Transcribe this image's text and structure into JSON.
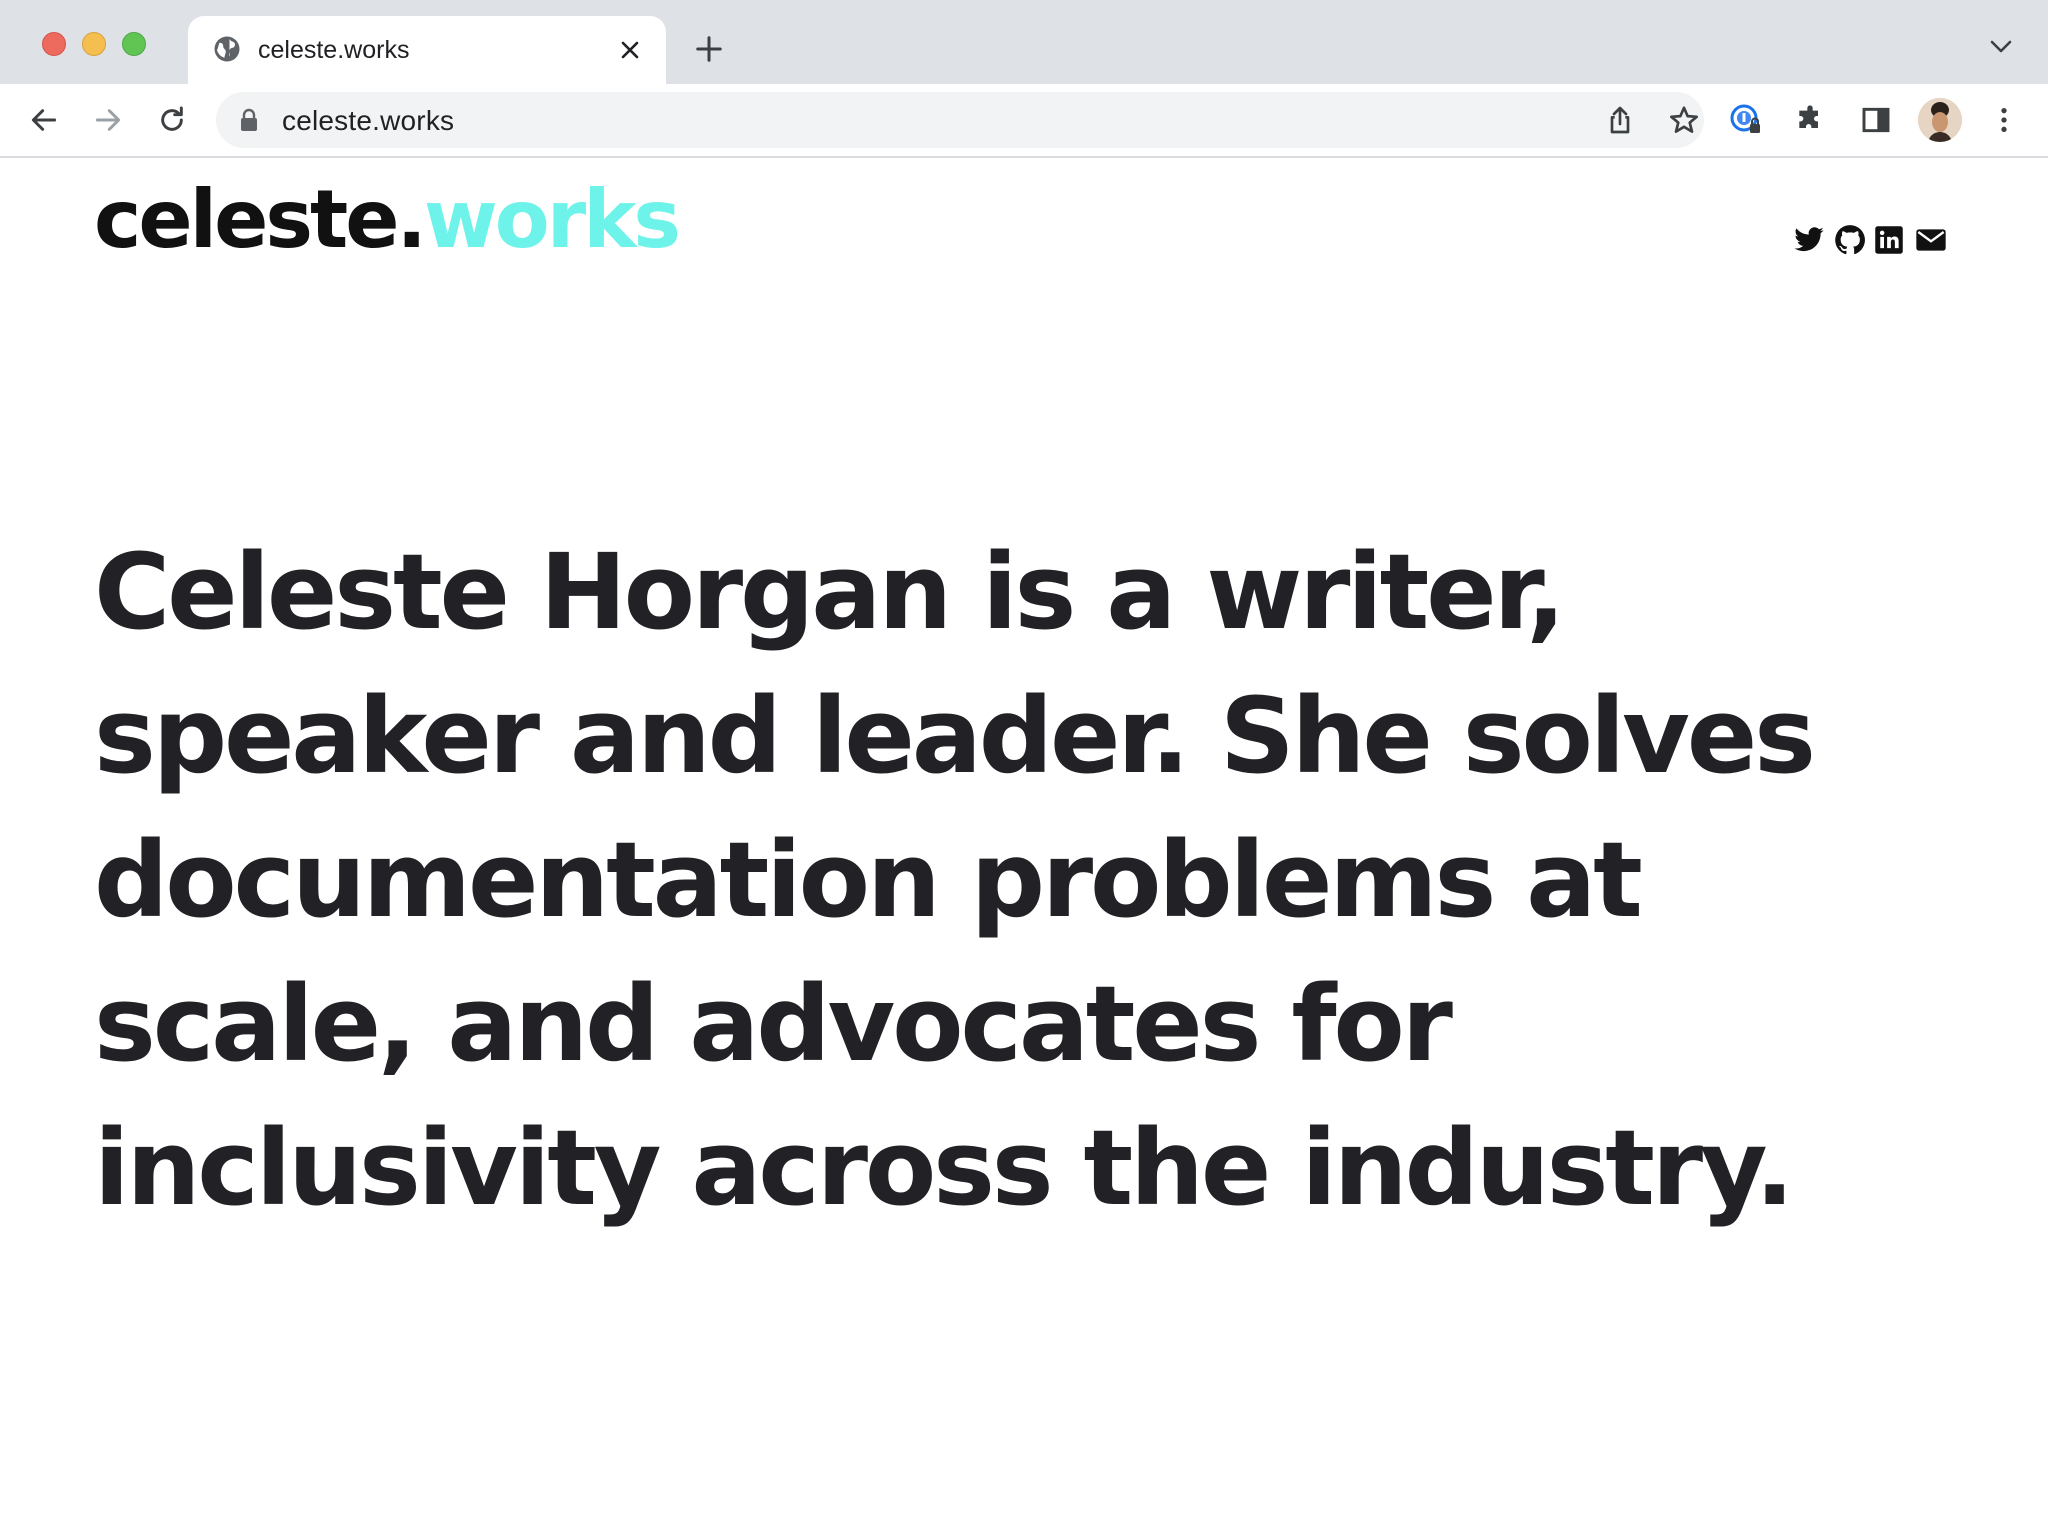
{
  "browser": {
    "tab": {
      "title": "celeste.works"
    },
    "address_bar": {
      "url": "celeste.works"
    }
  },
  "site": {
    "logo": {
      "part1": "celeste.",
      "part2": "works",
      "accent_color": "#6ef3ea"
    },
    "social_links": [
      {
        "icon": "twitter-icon"
      },
      {
        "icon": "github-icon"
      },
      {
        "icon": "linkedin-icon"
      },
      {
        "icon": "email-icon"
      }
    ],
    "hero": {
      "text": "Celeste Horgan is a writer, speaker and leader. She solves documentation problems at scale, and advocates for inclusivity across the industry."
    }
  }
}
